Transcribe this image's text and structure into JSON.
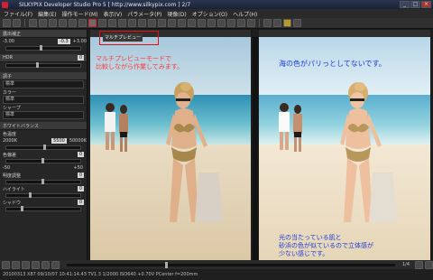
{
  "window": {
    "title": "SILKYPIX Developer Studio Pro 5 [ http://www.silkypix.com ]  2/7",
    "minimize": "_",
    "maximize": "□",
    "close": "×"
  },
  "menu": [
    "ファイル(F)",
    "編集(E)",
    "操作モード(M)",
    "表示(V)",
    "パラメータ(P)",
    "現像(D)",
    "オプション(O)",
    "ヘルプ(H)"
  ],
  "left_panel": {
    "exposure_label": "露出補正",
    "exposure_value": "-0.3",
    "exposure_min": "-3.00",
    "exposure_max": "+3.00",
    "hdr_label": "HDR",
    "hdr_value": "0",
    "tone_label": "調子",
    "tone_value": "標準",
    "color_label": "カラー",
    "color_value": "標準",
    "sharp_label": "シャープ",
    "sharp_value": "標準",
    "wb_section": "ホワイトバランス",
    "colortemp_label": "色温度",
    "colortemp_min": "2000K",
    "colortemp_value": "5500",
    "colortemp_max": "50000K",
    "tint_label": "色偏差",
    "tint_value": "0",
    "tint_min": "-50",
    "tint_max": "+50",
    "contrast_label": "明度調整",
    "contrast_value": "0",
    "highlight_label": "ハイライト",
    "highlight_value": "0",
    "blackpoint_label": "シャドウ",
    "blackpoint_value": "0"
  },
  "callout": {
    "label": "マルチプレビュー"
  },
  "annotations": {
    "left_line1": "マルチプレビューモードで",
    "left_line2": "比較しながら作業してみます。",
    "right_top": "海の色がパリっとしてないです。",
    "bottom_line1": "光の当たっている肌と",
    "bottom_line2": "砂浜の色が似ているので立体感が",
    "bottom_line3": "少ない感じです。"
  },
  "status": {
    "zoom": "1/4",
    "info": "20100313 X87 09/10/07 10:41:14.43 TV1.3 1/2000 ISO640 +0.70V PCenter f=200mm"
  },
  "colors": {
    "callout_border": "#e01010",
    "annotation_red": "#ff3b3b",
    "annotation_blue": "#1a3bd6"
  }
}
